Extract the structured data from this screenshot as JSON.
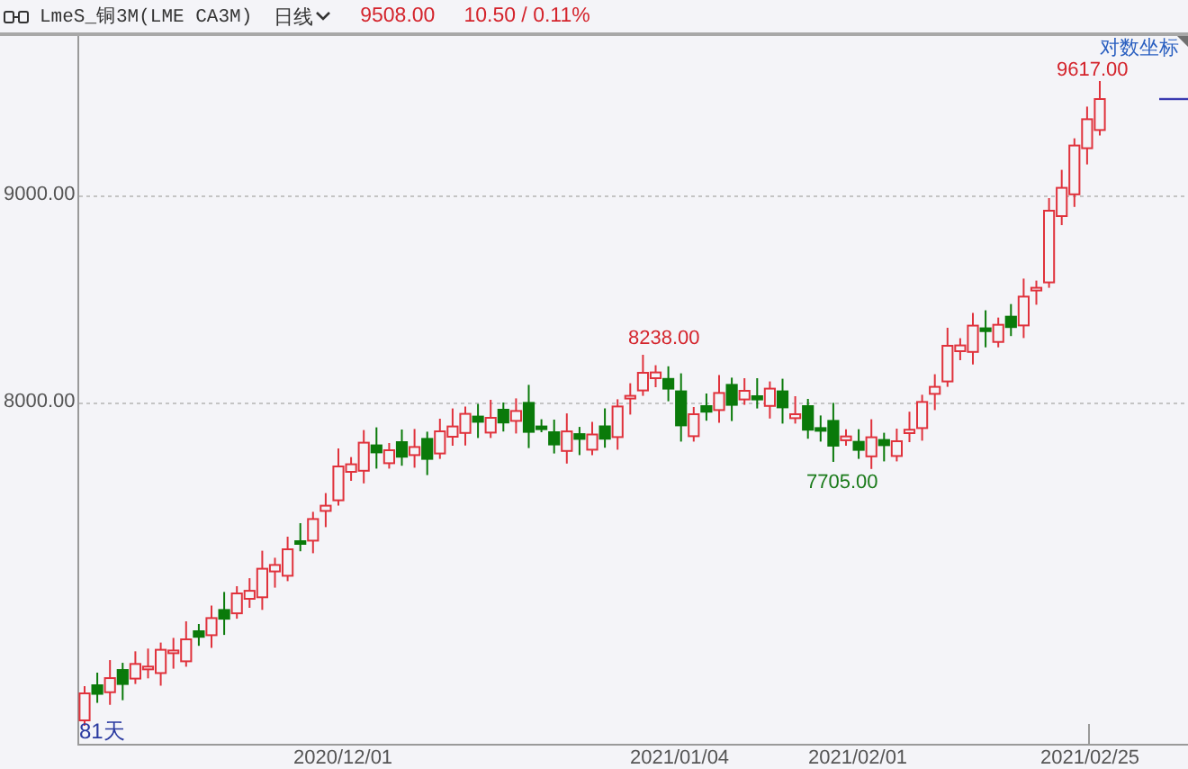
{
  "header": {
    "symbol": "LmeS_铜3M(LME CA3M)",
    "period": "日线",
    "price": "9508.00",
    "change": "10.50 / 0.11%"
  },
  "chart": {
    "scale_label": "对数坐标",
    "y_ticks": [
      "9000.00",
      "8000.00"
    ],
    "x_ticks": [
      "2020/12/01",
      "2021/01/04",
      "2021/02/01",
      "2021/02/25"
    ],
    "max_label": "9617.00",
    "high_label": "8238.00",
    "low_label": "7705.00",
    "day_count": "81天"
  }
}
